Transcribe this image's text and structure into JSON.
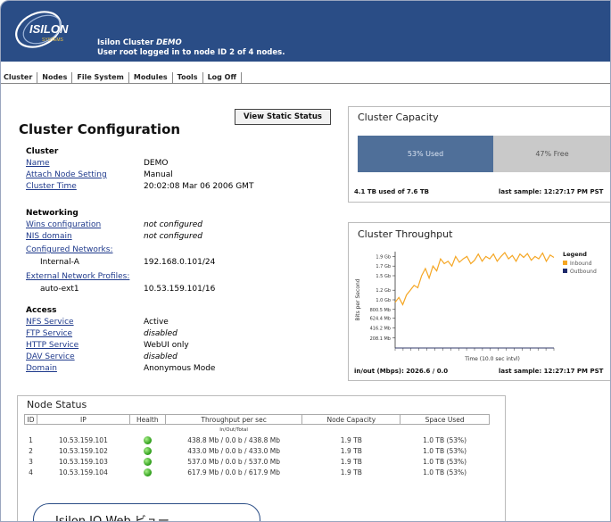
{
  "header": {
    "logo_text": "ISILON",
    "logo_sub": "SYSTEMS",
    "cluster_prefix": "Isilon Cluster",
    "cluster_name": "DEMO",
    "login_line": "User root logged in to node ID 2 of 4 nodes."
  },
  "nav": [
    "Cluster",
    "Nodes",
    "File System",
    "Modules",
    "Tools",
    "Log Off"
  ],
  "cluster_config": {
    "title": "Cluster Configuration",
    "view_static_label": "View Static Status",
    "sections": {
      "cluster": "Cluster",
      "networking": "Networking",
      "access": "Access"
    },
    "cluster_rows": [
      {
        "label": "Name",
        "value": "DEMO"
      },
      {
        "label": "Attach Node Setting",
        "value": "Manual"
      },
      {
        "label": "Cluster Time",
        "value": "20:02:08 Mar 06 2006 GMT"
      }
    ],
    "networking_rows": [
      {
        "label": "Wins configuration",
        "value": "not configured"
      },
      {
        "label": "NIS domain",
        "value": "not configured"
      },
      {
        "label": "Configured Networks:",
        "value": ""
      },
      {
        "label": "Internal-A",
        "value": "192.168.0.101/24"
      },
      {
        "label": "External Network Profiles:",
        "value": ""
      },
      {
        "label": "auto-ext1",
        "value": "10.53.159.101/16"
      }
    ],
    "access_rows": [
      {
        "label": "NFS Service",
        "value": "Active"
      },
      {
        "label": "FTP Service",
        "value": "disabled"
      },
      {
        "label": "HTTP Service",
        "value": "WebUI only"
      },
      {
        "label": "DAV Service",
        "value": "disabled"
      },
      {
        "label": "Domain",
        "value": "Anonymous Mode"
      }
    ]
  },
  "capacity": {
    "title": "Cluster Capacity",
    "used_label": "53% Used",
    "free_label": "47% Free",
    "used_fraction": 0.53,
    "summary": "4.1 TB used of 7.6 TB",
    "last_sample": "last sample: 12:27:17 PM PST"
  },
  "throughput": {
    "title": "Cluster Throughput",
    "legend_title": "Legend",
    "inbound_label": "Inbound",
    "outbound_label": "Outbound",
    "inbound_color": "#f5a623",
    "outbound_color": "#1f2a6b",
    "ylabel": "Bits per Second",
    "xlabel": "Time (10.0 sec intvl)",
    "summary": "in/out (Mbps): 2026.6 / 0.0",
    "last_sample": "last sample: 12:27:17 PM PST"
  },
  "chart_data": {
    "type": "line",
    "title": "Cluster Throughput",
    "xlabel": "Time (10.0 sec intvl)",
    "ylabel": "Bits per Second",
    "y_ticks": [
      "1.9 Gb",
      "1.7 Gb",
      "1.5 Gb",
      "1.2 Gb",
      "1.0 Gb",
      "800.5 Mb",
      "624.4 Mb",
      "416.2 Mb",
      "208.1 Mb"
    ],
    "y_tick_values": [
      1.9,
      1.7,
      1.5,
      1.2,
      1.0,
      0.8005,
      0.6244,
      0.4162,
      0.2081
    ],
    "ylim": [
      0,
      2.0
    ],
    "series": [
      {
        "name": "Inbound",
        "values": [
          0.95,
          1.05,
          0.9,
          1.1,
          1.2,
          1.3,
          1.25,
          1.5,
          1.65,
          1.45,
          1.7,
          1.6,
          1.85,
          1.75,
          1.8,
          1.7,
          1.9,
          1.78,
          1.85,
          1.9,
          1.75,
          1.82,
          1.95,
          1.8,
          1.9,
          1.85,
          1.95,
          1.8,
          1.9,
          1.98,
          1.85,
          1.92,
          1.8,
          1.95,
          1.88,
          1.96,
          1.82,
          1.9,
          1.85,
          1.97,
          1.8,
          1.93,
          1.88
        ]
      },
      {
        "name": "Outbound",
        "values": [
          0,
          0,
          0,
          0,
          0,
          0,
          0,
          0,
          0,
          0,
          0,
          0,
          0,
          0,
          0,
          0,
          0,
          0,
          0,
          0,
          0,
          0,
          0,
          0,
          0,
          0,
          0,
          0,
          0,
          0,
          0,
          0,
          0,
          0,
          0,
          0,
          0,
          0,
          0,
          0,
          0,
          0,
          0
        ]
      }
    ],
    "legend": "right"
  },
  "node_status": {
    "title": "Node Status",
    "headers": [
      "ID",
      "IP",
      "Health",
      "Throughput per sec",
      "Node Capacity",
      "Space Used"
    ],
    "sub_header": "In/Out/Total",
    "rows": [
      {
        "id": "1",
        "ip": "10.53.159.101",
        "throughput": "438.8 Mb / 0.0 b / 438.8 Mb",
        "capacity": "1.9 TB",
        "used": "1.0 TB  (53%)"
      },
      {
        "id": "2",
        "ip": "10.53.159.102",
        "throughput": "433.0 Mb / 0.0 b / 433.0 Mb",
        "capacity": "1.9 TB",
        "used": "1.0 TB  (53%)"
      },
      {
        "id": "3",
        "ip": "10.53.159.103",
        "throughput": "537.0 Mb / 0.0 b / 537.0 Mb",
        "capacity": "1.9 TB",
        "used": "1.0 TB  (53%)"
      },
      {
        "id": "4",
        "ip": "10.53.159.104",
        "throughput": "617.9 Mb / 0.0 b / 617.9 Mb",
        "capacity": "1.9 TB",
        "used": "1.0 TB  (53%)"
      }
    ]
  },
  "caption": "Isilon IQ Web ビュー"
}
